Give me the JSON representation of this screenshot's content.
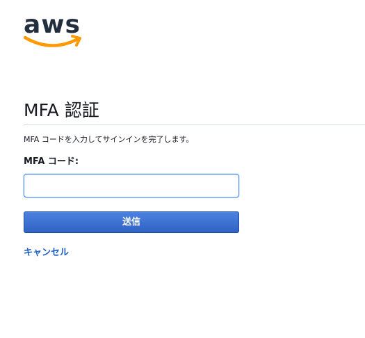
{
  "logo": {
    "text": "aws",
    "text_color": "#232f3e",
    "smile_color": "#f90"
  },
  "page": {
    "title": "MFA 認証",
    "instruction": "MFA コードを入力してサインインを完了します。"
  },
  "form": {
    "mfa_label": "MFA コード:",
    "mfa_value": "",
    "mfa_placeholder": "",
    "submit_label": "送信",
    "cancel_label": "キャンセル"
  },
  "colors": {
    "button": "#3b6fd2",
    "link": "#1a5ec2",
    "input_focus": "#4d8ef0"
  }
}
